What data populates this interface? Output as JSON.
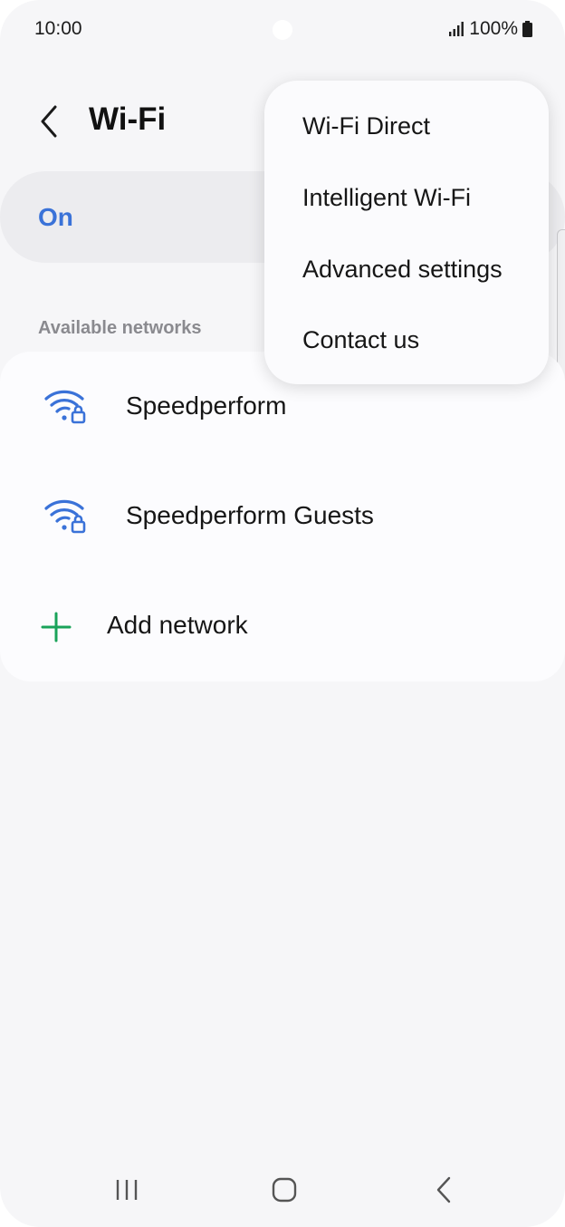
{
  "status_bar": {
    "time": "10:00",
    "battery": "100%"
  },
  "header": {
    "title": "Wi-Fi"
  },
  "wifi_toggle": {
    "label": "On"
  },
  "section": {
    "available_networks": "Available networks"
  },
  "networks": [
    {
      "name": "Speedperform",
      "secured": true
    },
    {
      "name": "Speedperform Guests",
      "secured": true
    }
  ],
  "add_network": {
    "label": "Add network"
  },
  "menu": {
    "items": [
      {
        "label": "Wi-Fi Direct"
      },
      {
        "label": "Intelligent Wi-Fi"
      },
      {
        "label": "Advanced settings"
      },
      {
        "label": "Contact us"
      }
    ]
  },
  "colors": {
    "accent": "#3a72d8",
    "add_icon": "#1aa35a",
    "background": "#f6f6f8"
  },
  "icons": {
    "back": "chevron-left-icon",
    "wifi": "wifi-lock-icon",
    "add": "plus-icon",
    "nav_recents": "recents-icon",
    "nav_home": "home-icon",
    "nav_back": "back-icon"
  }
}
